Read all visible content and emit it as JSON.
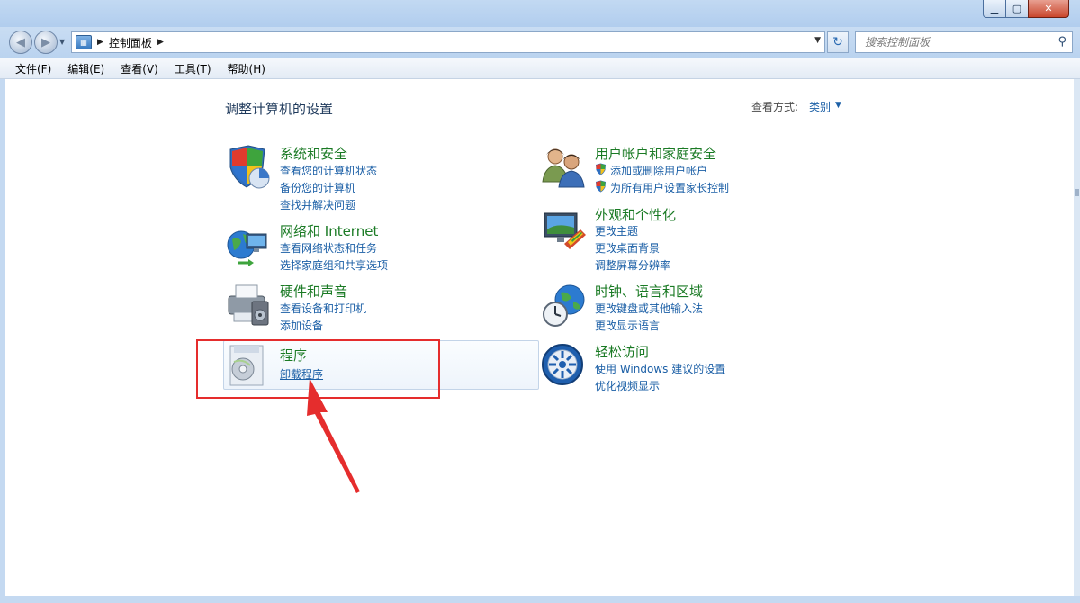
{
  "window": {
    "minimize_icon": "minimize-icon",
    "maximize_icon": "maximize-icon",
    "close_icon": "close-icon"
  },
  "nav": {
    "address_path": "控制面板",
    "search_placeholder": "搜索控制面板"
  },
  "menu": [
    "文件(F)",
    "编辑(E)",
    "查看(V)",
    "工具(T)",
    "帮助(H)"
  ],
  "main": {
    "title": "调整计算机的设置",
    "view_by_label": "查看方式:",
    "view_by_value": "类别"
  },
  "categories": [
    {
      "title": "系统和安全",
      "icon": "shield-pie-icon",
      "links": [
        "查看您的计算机状态",
        "备份您的计算机",
        "查找并解决问题"
      ]
    },
    {
      "title": "网络和 Internet",
      "icon": "network-globe-icon",
      "links": [
        "查看网络状态和任务",
        "选择家庭组和共享选项"
      ]
    },
    {
      "title": "硬件和声音",
      "icon": "printer-icon",
      "links": [
        "查看设备和打印机",
        "添加设备"
      ]
    },
    {
      "title": "程序",
      "icon": "programs-icon",
      "links": [
        "卸载程序"
      ]
    },
    {
      "title": "用户帐户和家庭安全",
      "icon": "users-icon",
      "links": [
        "添加或删除用户帐户",
        "为所有用户设置家长控制"
      ]
    },
    {
      "title": "外观和个性化",
      "icon": "monitor-paint-icon",
      "links": [
        "更改主题",
        "更改桌面背景",
        "调整屏幕分辨率"
      ]
    },
    {
      "title": "时钟、语言和区域",
      "icon": "clock-globe-icon",
      "links": [
        "更改键盘或其他输入法",
        "更改显示语言"
      ]
    },
    {
      "title": "轻松访问",
      "icon": "ease-of-access-icon",
      "links": [
        "使用 Windows 建议的设置",
        "优化视频显示"
      ]
    }
  ],
  "annotation": {
    "color": "#e52d2d"
  }
}
